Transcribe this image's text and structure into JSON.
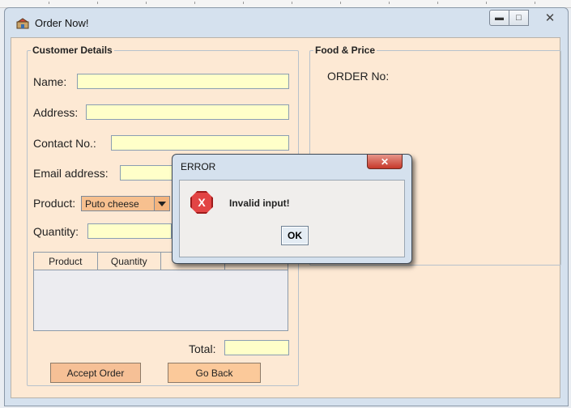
{
  "window": {
    "title": "Order Now!"
  },
  "customer": {
    "legend": "Customer Details",
    "name_label": "Name:",
    "address_label": "Address:",
    "contact_label": "Contact No.:",
    "email_label": "Email address:",
    "product_label": "Product:",
    "product_value": "Puto cheese",
    "quantity_label": "Quantity:",
    "table_headers": [
      "Product",
      "Quantity"
    ],
    "total_label": "Total:"
  },
  "food": {
    "legend": "Food & Price",
    "order_label": "ORDER No:"
  },
  "buttons": {
    "accept": "Accept Order",
    "back": "Go Back"
  },
  "dialog": {
    "title": "ERROR",
    "message": "Invalid input!",
    "ok": "OK"
  }
}
